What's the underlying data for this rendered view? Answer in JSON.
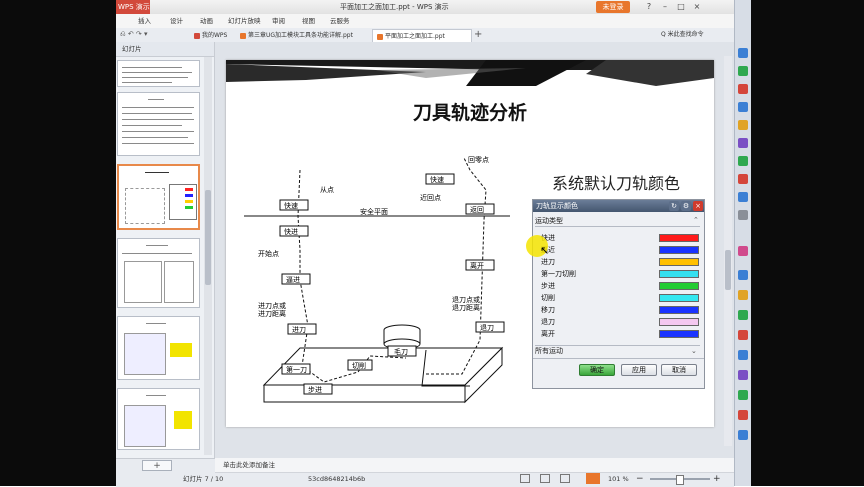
{
  "window": {
    "app_button": "WPS 演示",
    "title": "平面加工之面加工.ppt - WPS 演示",
    "login": "未登录",
    "controls": [
      "?",
      "–",
      "□",
      "×"
    ]
  },
  "menu": {
    "items": [
      "插入",
      "设计",
      "动画",
      "幻灯片放映",
      "审阅",
      "视图",
      "云服务"
    ],
    "search_placeholder": "Q 米此查找命令"
  },
  "tabs": [
    {
      "label": "我的WPS",
      "active": false
    },
    {
      "label": "第三章UG加工模块工具条功能详解.ppt",
      "active": false
    },
    {
      "label": "平面加工之面加工.ppt",
      "active": true
    }
  ],
  "left_panel": {
    "tab_label": "幻灯片"
  },
  "slide": {
    "title": "刀具轨迹分析",
    "subtitle": "系统默认刀轨颜色",
    "diagram": {
      "labels": {
        "return_point": "回零点",
        "fast_top": "快速",
        "near_return": "近回点",
        "from_point": "从点",
        "fast_left": "快速",
        "back": "返回",
        "fast_mid": "快进",
        "safe_plane": "安全平面",
        "start_point": "开始点",
        "approach": "逼进",
        "approach_point": "进刀点或\n进刀距离",
        "feed_in": "进刀",
        "first_cut": "第一刀",
        "step": "步进",
        "cut": "切削",
        "workpiece": "毛刀",
        "leave": "离开",
        "retract_point": "退刀点或\n退刀距离",
        "retract": "退刀"
      }
    }
  },
  "dialog": {
    "title": "刀轨显示颜色",
    "section": "运动类型",
    "rows": [
      {
        "label": "快进",
        "color": "#ff1a1a"
      },
      {
        "label": "逼近",
        "color": "#1a33ff"
      },
      {
        "label": "进刀",
        "color": "#ffc000"
      },
      {
        "label": "第一刀切削",
        "color": "#33e0f0"
      },
      {
        "label": "步进",
        "color": "#22cc33"
      },
      {
        "label": "切削",
        "color": "#33e8f0"
      },
      {
        "label": "移刀",
        "color": "#1a33ff"
      },
      {
        "label": "退刀",
        "color": "#f4c8f0"
      },
      {
        "label": "离开",
        "color": "#1a33ff"
      }
    ],
    "all_motion": "所有运动",
    "buttons": [
      "确定",
      "应用",
      "取消"
    ]
  },
  "status": {
    "notes_placeholder": "单击此处添加备注",
    "slide_counter": "幻灯片 7 / 10",
    "file_hash": "53cd8648214b6b",
    "zoom": "101 %"
  }
}
